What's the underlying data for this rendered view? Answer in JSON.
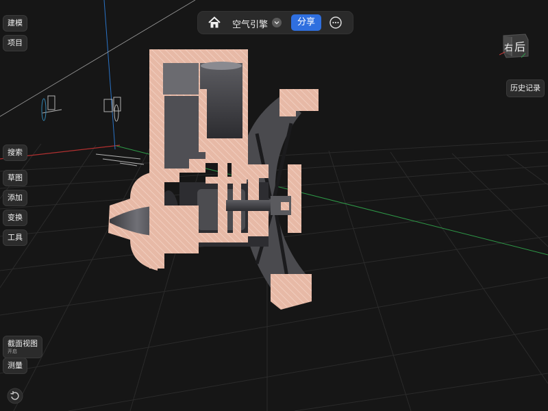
{
  "topbar": {
    "home_icon": "home-icon",
    "title": "空气引擎",
    "share_label": "分享",
    "dropdown_icon": "chevron-down-icon",
    "more_icon": "more-icon"
  },
  "sidebar": {
    "build": "建模",
    "project": "项目",
    "search": "搜索",
    "sketch": "草图",
    "add": "添加",
    "transform": "变换",
    "tools": "工具",
    "section_view": "截面视图",
    "section_view_status": "开启",
    "measure": "测量"
  },
  "viewcube": {
    "right_face": "右",
    "back_face": "后"
  },
  "history_label": "历史记录",
  "colors": {
    "accent": "#2f6fdf",
    "section_fill": "#e5b8a5",
    "metal": "#5b5b5f",
    "background": "#161616"
  }
}
